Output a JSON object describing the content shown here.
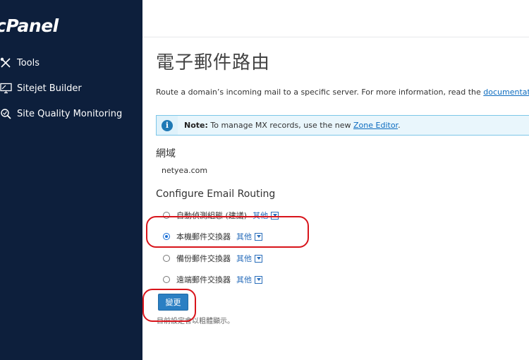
{
  "sidebar": {
    "logo": "cPanel",
    "items": [
      {
        "label": "Tools",
        "icon": "tools-icon"
      },
      {
        "label": "Sitejet Builder",
        "icon": "monitor-icon"
      },
      {
        "label": "Site Quality Monitoring",
        "icon": "magnifier-icon"
      }
    ]
  },
  "page": {
    "title": "電子郵件路由",
    "description_prefix": "Route a domain’s incoming mail to a specific server. For more information, read the ",
    "description_link": "documentation",
    "description_suffix": "."
  },
  "note": {
    "icon": "info-icon",
    "bold": "Note:",
    "text": " To manage MX records, use the new ",
    "link": "Zone Editor",
    "suffix": "."
  },
  "domain": {
    "label": "網域",
    "value": "netyea.com"
  },
  "routing": {
    "title": "Configure Email Routing",
    "options": [
      {
        "label": "自動偵測組態 (建議)",
        "other": "其他",
        "checked": false
      },
      {
        "label": "本機郵件交換器",
        "other": "其他",
        "checked": true
      },
      {
        "label": "備份郵件交換器",
        "other": "其他",
        "checked": false
      },
      {
        "label": "遠端郵件交換器",
        "other": "其他",
        "checked": false
      }
    ],
    "submit_label": "變更",
    "footnote": "目前設定會以粗體顯示。"
  },
  "colors": {
    "sidebar_bg": "#0d1f3c",
    "accent": "#2b7fc3",
    "annotation": "#d8141b"
  }
}
